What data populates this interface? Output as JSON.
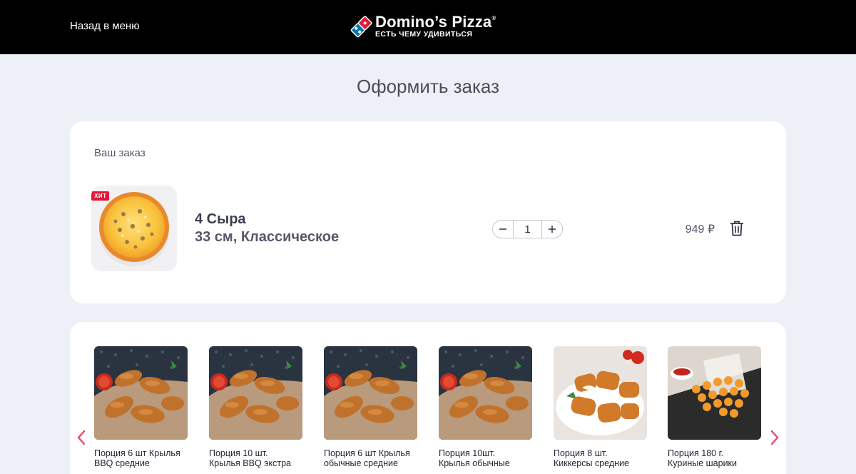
{
  "header": {
    "back_label": "Назад в меню",
    "logo_name": "Domino’s Pizza",
    "logo_reg": "®",
    "logo_tagline": "ЕСТЬ ЧЕМУ УДИВИТЬСЯ"
  },
  "page_title": "Оформить заказ",
  "order": {
    "heading": "Ваш заказ",
    "items": [
      {
        "badge": "ХИТ",
        "name": "4 Сыра",
        "details": "33 см, Классическое",
        "quantity": "1",
        "price": "949 ₽",
        "image_icon": "pizza-image"
      }
    ]
  },
  "upsell": {
    "products": [
      {
        "line1": "Порция 6 шт Крылья",
        "line2": "BBQ средние",
        "image_icon": "chicken-wings-image"
      },
      {
        "line1": "Порция 10 шт.",
        "line2": "Крылья BBQ экстра",
        "image_icon": "chicken-wings-image"
      },
      {
        "line1": "Порция 6 шт Крылья",
        "line2": "обычные средние",
        "image_icon": "chicken-wings-image"
      },
      {
        "line1": "Порция 10шт.",
        "line2": "Крылья обычные",
        "image_icon": "chicken-wings-image"
      },
      {
        "line1": "Порция 8 шт.",
        "line2": "Киккерсы средние",
        "image_icon": "chicken-nuggets-image"
      },
      {
        "line1": "Порция 180 г.",
        "line2": "Куриные шарики",
        "image_icon": "chicken-balls-image"
      }
    ]
  },
  "colors": {
    "header_bg": "#000000",
    "page_bg": "#eef0f7",
    "accent_red": "#e31837",
    "brand_blue": "#0078ae",
    "arrow_pink": "#e8507a"
  }
}
